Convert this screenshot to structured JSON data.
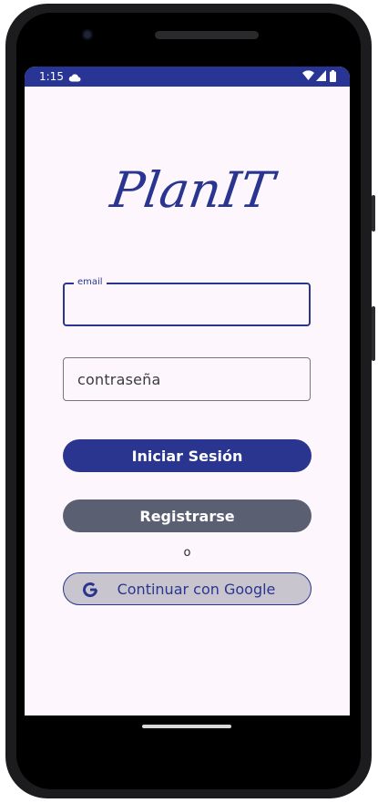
{
  "status_bar": {
    "time": "1:15",
    "icons": [
      "cloud-icon",
      "wifi-icon",
      "signal-icon",
      "battery-icon"
    ],
    "background": "#293595"
  },
  "app": {
    "logo_text": "PlanIT",
    "brand_color": "#2a3590"
  },
  "form": {
    "email_label": "email",
    "email_value": "",
    "password_placeholder": "contraseña",
    "password_value": ""
  },
  "buttons": {
    "login_label": "Iniciar Sesión",
    "register_label": "Registrarse",
    "separator": "o",
    "google_label": "Continuar con Google"
  },
  "colors": {
    "screen_background": "#fdf7fd",
    "login_button": "#2a3590",
    "register_button": "#5b5f72",
    "google_button": "#c9c5cf"
  }
}
